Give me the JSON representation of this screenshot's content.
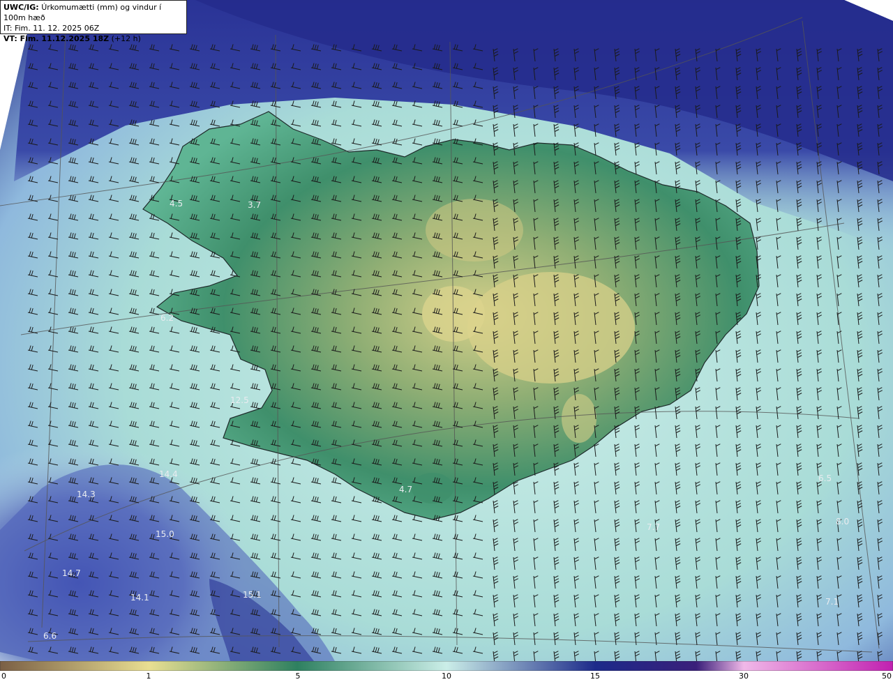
{
  "header": {
    "line1_prefix": "UWC/IG:",
    "line1_text": "Úrkomumætti (mm) og vindur í 100m hæð",
    "line2": "IT: Fim. 11. 12. 2025 06Z",
    "line3_prefix": "VT: Fim. 11.12.2025 18Z",
    "line3_suffix": "(+12 h)"
  },
  "colorbar": {
    "tick_labels": [
      "0",
      "1",
      "5",
      "10",
      "15",
      "30",
      "50"
    ],
    "colors": [
      "#7a5f45",
      "#e9df92",
      "#2e8060",
      "#cbeee8",
      "#1c2a8a",
      "#3a1f7a",
      "#f0b8e8",
      "#c020b0"
    ]
  },
  "map_labels": [
    "4.5",
    "3.7",
    "6.2",
    "12.5",
    "14.4",
    "14.3",
    "15.0",
    "14.7",
    "14.1",
    "15.1",
    "6.6",
    "4.7",
    "6.5",
    "8.0",
    "7.7",
    "7.1"
  ],
  "colors": {
    "ocean_deep": "#27308f",
    "ocean_mid": "#6f86c6",
    "ocean_light": "#cdeee9",
    "land_green": "#3f8f6b",
    "land_yellow": "#d4cf88",
    "coast": "#1f2b2b",
    "barb": "#1a1a1a"
  }
}
